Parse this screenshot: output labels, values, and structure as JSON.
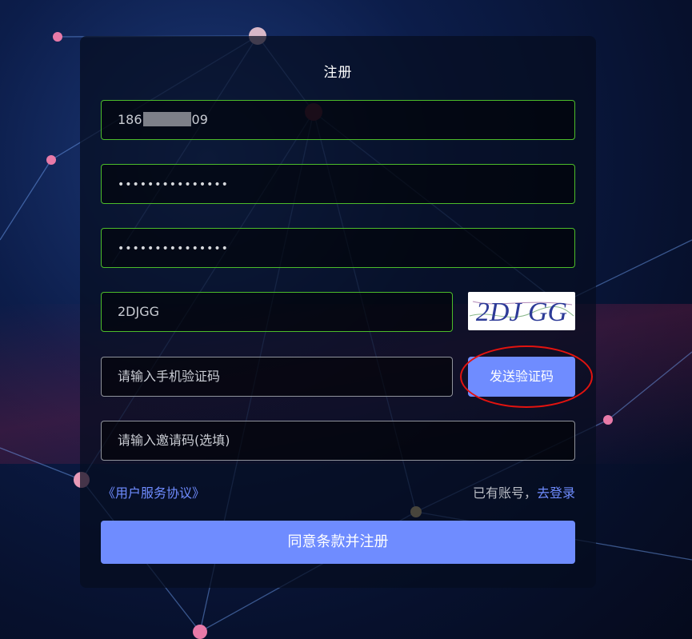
{
  "form": {
    "title": "注册",
    "phone_prefix": "186",
    "phone_suffix": "09",
    "password_mask": "•••••••••••••••",
    "confirm_mask": "•••••••••••••••",
    "captcha_value": "2DJGG",
    "captcha_image_text": "2DJ GG",
    "sms_placeholder": "请输入手机验证码",
    "send_code_label": "发送验证码",
    "invite_placeholder": "请输入邀请码(选填)",
    "agreement_link": "《用户服务协议》",
    "have_account": "已有账号，",
    "login_link": "去登录",
    "submit_label": "同意条款并注册"
  },
  "colors": {
    "accent": "#6f8cff",
    "valid_border": "#4cbc2a",
    "neutral_border": "#8f939b",
    "highlight": "#e3130f"
  }
}
